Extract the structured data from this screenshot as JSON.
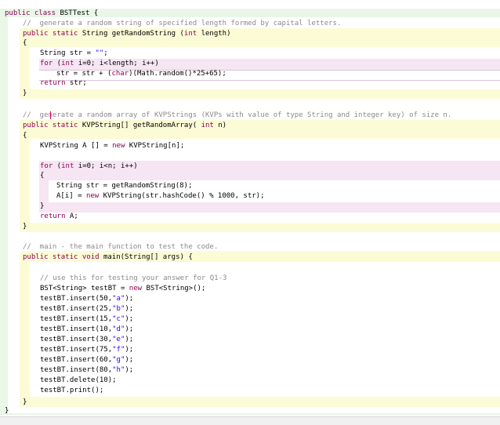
{
  "colors": {
    "class_bg": "#e8f7e6",
    "method_bg": "#fbfbd6",
    "block_bg": "#f6e5f3",
    "keyword": "#8f0055",
    "comment": "#8a8a8a",
    "string": "#2a00ff"
  },
  "code": {
    "class_decl": [
      {
        "t": "public class ",
        "c": "kw"
      },
      {
        "t": "BSTTest {",
        "c": ""
      }
    ],
    "c1": [
      {
        "t": "//  generate a random string of specified length formed by capital letters.",
        "c": "cm"
      }
    ],
    "m1_sig": [
      {
        "t": "public static ",
        "c": "kw"
      },
      {
        "t": "String getRandomString (",
        "c": ""
      },
      {
        "t": "int",
        "c": "kw"
      },
      {
        "t": " length)",
        "c": ""
      }
    ],
    "m1_open": [
      {
        "t": "{",
        "c": ""
      }
    ],
    "m1_l1": [
      {
        "t": "String str = ",
        "c": ""
      },
      {
        "t": "\"\"",
        "c": "st"
      },
      {
        "t": ";",
        "c": ""
      }
    ],
    "m1_for": [
      {
        "t": "for",
        "c": "kw"
      },
      {
        "t": " (",
        "c": ""
      },
      {
        "t": "int",
        "c": "kw"
      },
      {
        "t": " i=0; i<length; i++)",
        "c": ""
      }
    ],
    "m1_body": [
      {
        "t": "str = str + (",
        "c": ""
      },
      {
        "t": "char",
        "c": "kw"
      },
      {
        "t": ")(Math.random()*25+65);",
        "c": ""
      }
    ],
    "m1_ret": [
      {
        "t": "return",
        "c": "kw"
      },
      {
        "t": " str;",
        "c": ""
      }
    ],
    "m1_close": [
      {
        "t": "}",
        "c": ""
      }
    ],
    "c2": [
      {
        "t": "//  generate a random array of KVPStrings (KVPs with value of type String and integer key) of size n.",
        "c": "cm"
      }
    ],
    "m2_sig": [
      {
        "t": "public static ",
        "c": "kw"
      },
      {
        "t": "KVPString[] getRandomArray( ",
        "c": ""
      },
      {
        "t": "int",
        "c": "kw"
      },
      {
        "t": " n)",
        "c": ""
      }
    ],
    "m2_open": [
      {
        "t": "{",
        "c": ""
      }
    ],
    "m2_l1": [
      {
        "t": "KVPString A [] = ",
        "c": ""
      },
      {
        "t": "new",
        "c": "kw"
      },
      {
        "t": " KVPString[n];",
        "c": ""
      }
    ],
    "m2_for": [
      {
        "t": "for",
        "c": "kw"
      },
      {
        "t": " (",
        "c": ""
      },
      {
        "t": "int",
        "c": "kw"
      },
      {
        "t": " i=0; i<n; i++)",
        "c": ""
      }
    ],
    "m2_bopen": [
      {
        "t": "{",
        "c": ""
      }
    ],
    "m2_b1": [
      {
        "t": "String str = getRandomString(8);",
        "c": ""
      }
    ],
    "m2_b2": [
      {
        "t": "A[i] = ",
        "c": ""
      },
      {
        "t": "new",
        "c": "kw"
      },
      {
        "t": " KVPString(str.hashCode() % 1000, str);",
        "c": ""
      }
    ],
    "m2_bclose": [
      {
        "t": "}",
        "c": ""
      }
    ],
    "m2_ret": [
      {
        "t": "return",
        "c": "kw"
      },
      {
        "t": " A;",
        "c": ""
      }
    ],
    "m2_close": [
      {
        "t": "}",
        "c": ""
      }
    ],
    "c3": [
      {
        "t": "//  main - the main function to test the code.",
        "c": "cm"
      }
    ],
    "m3_sig": [
      {
        "t": "public static void ",
        "c": "kw"
      },
      {
        "t": "main(String[] args) {",
        "c": ""
      }
    ],
    "m3_c": [
      {
        "t": "// use this for testing your answer for Q1-3",
        "c": "cm"
      }
    ],
    "m3_l1": [
      {
        "t": "BST<String> testBT = ",
        "c": ""
      },
      {
        "t": "new",
        "c": "kw"
      },
      {
        "t": " BST<String>();",
        "c": ""
      }
    ],
    "m3_i1": [
      {
        "t": "testBT.insert(50,",
        "c": ""
      },
      {
        "t": "\"a\"",
        "c": "st"
      },
      {
        "t": ");",
        "c": ""
      }
    ],
    "m3_i2": [
      {
        "t": "testBT.insert(25,",
        "c": ""
      },
      {
        "t": "\"b\"",
        "c": "st"
      },
      {
        "t": ");",
        "c": ""
      }
    ],
    "m3_i3": [
      {
        "t": "testBT.insert(15,",
        "c": ""
      },
      {
        "t": "\"c\"",
        "c": "st"
      },
      {
        "t": ");",
        "c": ""
      }
    ],
    "m3_i4": [
      {
        "t": "testBT.insert(10,",
        "c": ""
      },
      {
        "t": "\"d\"",
        "c": "st"
      },
      {
        "t": ");",
        "c": ""
      }
    ],
    "m3_i5": [
      {
        "t": "testBT.insert(30,",
        "c": ""
      },
      {
        "t": "\"e\"",
        "c": "st"
      },
      {
        "t": ");",
        "c": ""
      }
    ],
    "m3_i6": [
      {
        "t": "testBT.insert(75,",
        "c": ""
      },
      {
        "t": "\"f\"",
        "c": "st"
      },
      {
        "t": ");",
        "c": ""
      }
    ],
    "m3_i7": [
      {
        "t": "testBT.insert(60,",
        "c": ""
      },
      {
        "t": "\"g\"",
        "c": "st"
      },
      {
        "t": ");",
        "c": ""
      }
    ],
    "m3_i8": [
      {
        "t": "testBT.insert(80,",
        "c": ""
      },
      {
        "t": "\"h\"",
        "c": "st"
      },
      {
        "t": ");",
        "c": ""
      }
    ],
    "m3_del": [
      {
        "t": "testBT.delete(10);",
        "c": ""
      }
    ],
    "m3_print": [
      {
        "t": "testBT.print();",
        "c": ""
      }
    ],
    "m3_close": [
      {
        "t": "}",
        "c": ""
      }
    ],
    "class_close": [
      {
        "t": "}",
        "c": ""
      }
    ]
  }
}
